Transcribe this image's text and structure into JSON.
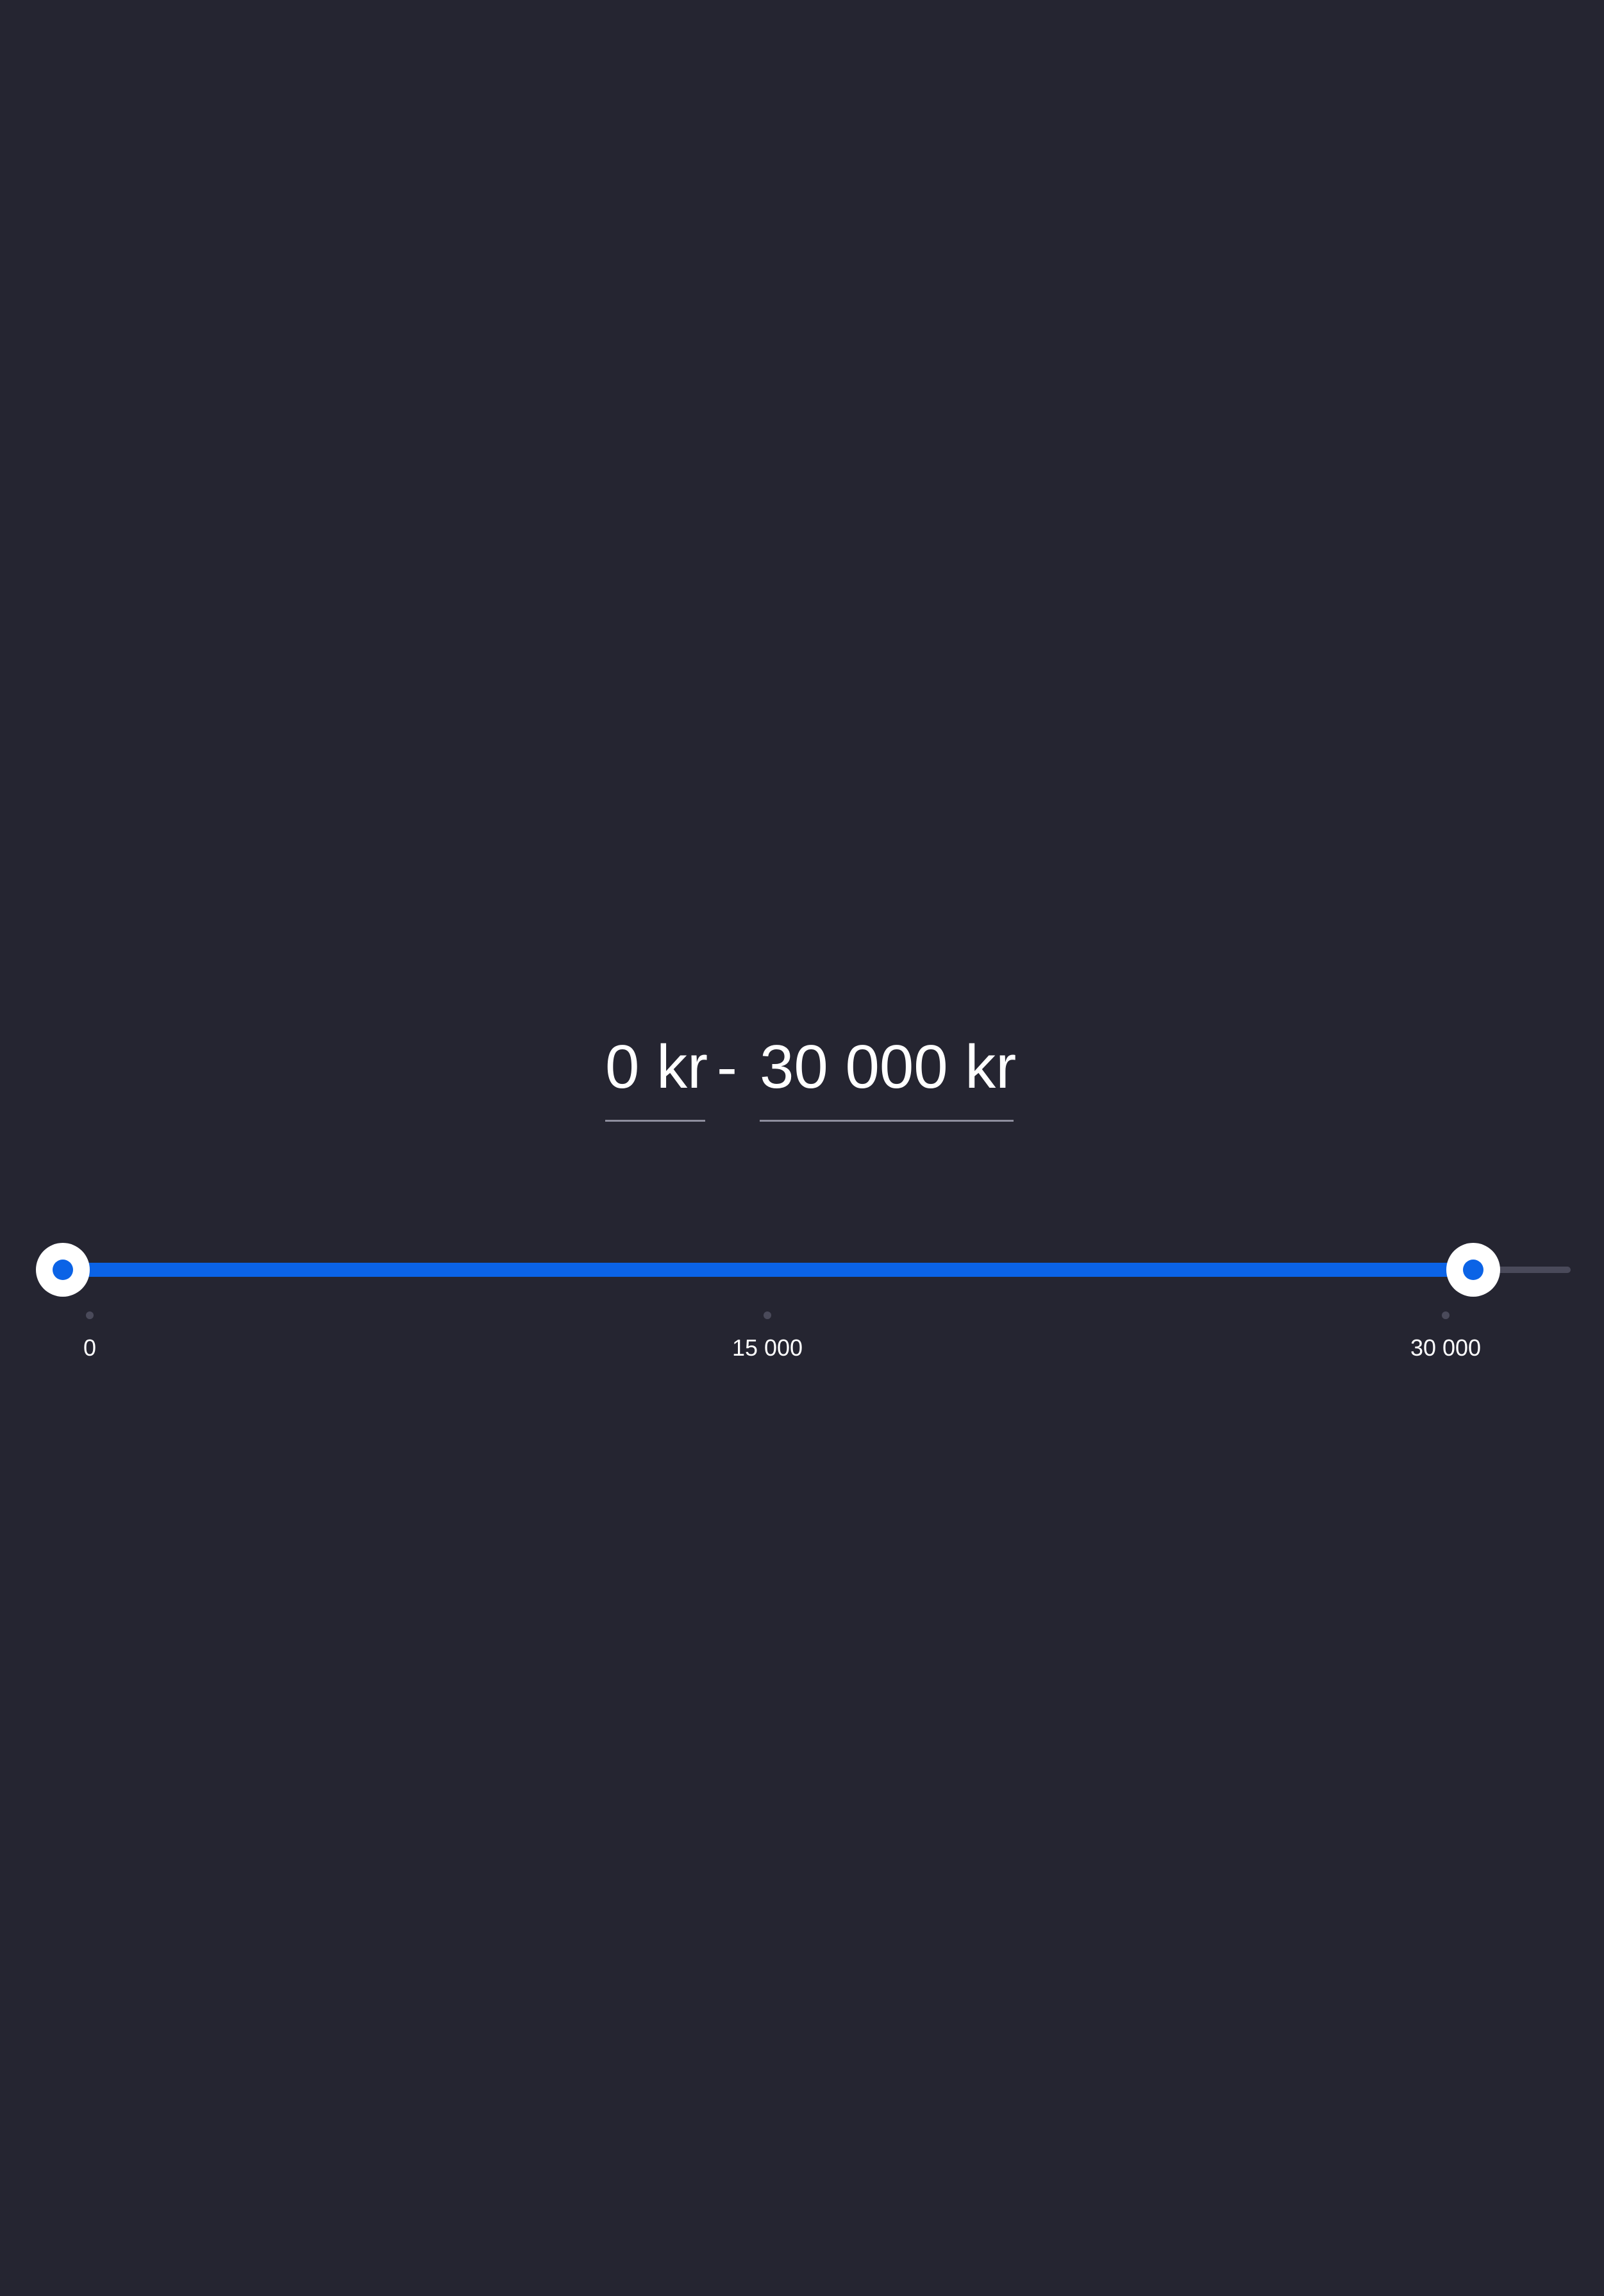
{
  "price_range": {
    "min_value": "0 kr",
    "separator": "-",
    "max_value": "30 000 kr"
  },
  "slider": {
    "range_min": 0,
    "range_max": 30000,
    "selected_min": 0,
    "selected_max": 30000,
    "ticks": [
      "0",
      "15 000",
      "30 000"
    ],
    "track_fill_color": "#0b63e6",
    "track_color": "#4a4a5a",
    "thumb_color": "#ffffff"
  },
  "colors": {
    "background": "#252531",
    "accent": "#0b63e6"
  }
}
